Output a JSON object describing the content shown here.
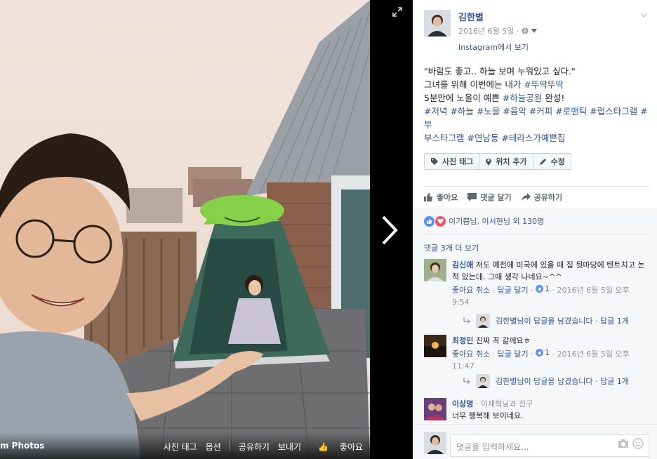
{
  "photo_bar": {
    "album_label": "m Photos",
    "actions": [
      "사진 태그",
      "옵션",
      "공유하기",
      "보내기",
      "좋아요"
    ]
  },
  "post": {
    "author": "김한별",
    "date": "2016년 6월 5일 ·",
    "source_link": "Instagram에서 보기",
    "body_lines": [
      [
        {
          "t": "\"바람도 좋고.. 하늘 보며 누워있고 싶다.\"",
          "tag": false
        }
      ],
      [
        {
          "t": "그녀를 위해 이번에는 내가 ",
          "tag": false
        },
        {
          "t": "#뚜딱뚜딱",
          "tag": true
        }
      ],
      [
        {
          "t": "5분만에 노을이 예쁜 ",
          "tag": false
        },
        {
          "t": "#하늘공원",
          "tag": true
        },
        {
          "t": " 완성!",
          "tag": false
        }
      ],
      [
        {
          "t": "#저녁 #하늘 #노을 #음악 #커피 #로맨틱 #럽스타그램 #부",
          "tag": true
        }
      ],
      [
        {
          "t": "부스타그램 #연남동 #테라스가예쁜집",
          "tag": true
        }
      ]
    ],
    "tag_buttons": [
      {
        "label": "사진 태그",
        "icon": "tag-icon"
      },
      {
        "label": "위치 추가",
        "icon": "location-pin-icon"
      },
      {
        "label": "수정",
        "icon": "pencil-icon"
      }
    ],
    "actions": [
      "좋아요",
      "댓글 달기",
      "공유하기"
    ],
    "reactions_text": "이기쁨님, 이서현님 외 130명",
    "more_comments": "댓글 3개 더 보기",
    "comments": [
      {
        "name": "김신애",
        "text": "저도 예전에 미국에 있을 때 집 뒷마당에 텐트치고 논적 있는데. 그때 생각 나네요~^^",
        "like_label": "좋아요",
        "cancel_label": "취소",
        "reply_label": "답글 달기",
        "likes": "1",
        "time": "2016년 6월 5일 오후 9:54",
        "reply_text": "김한별님이 답글을 남겼습니다 · 답글 1개"
      },
      {
        "name": "최정민",
        "text": "진짜 꼭 갈께요ㅎ",
        "like_label": "좋아요",
        "cancel_label": "취소",
        "reply_label": "답글 달기",
        "likes": "1",
        "time": "2016년 6월 5일 오후 11:47",
        "reply_text": "김한별님이 답글을 남겼습니다 · 답글 1개"
      },
      {
        "name": "이상명",
        "subtitle": "· 이재혁님과 친구",
        "text": "너무 행복해 보이네요."
      }
    ],
    "comment_placeholder": "댓글을 입력하세요..."
  },
  "colors": {
    "link": "#365899",
    "like_blue": "#5890ff",
    "love_red": "#f25268"
  }
}
